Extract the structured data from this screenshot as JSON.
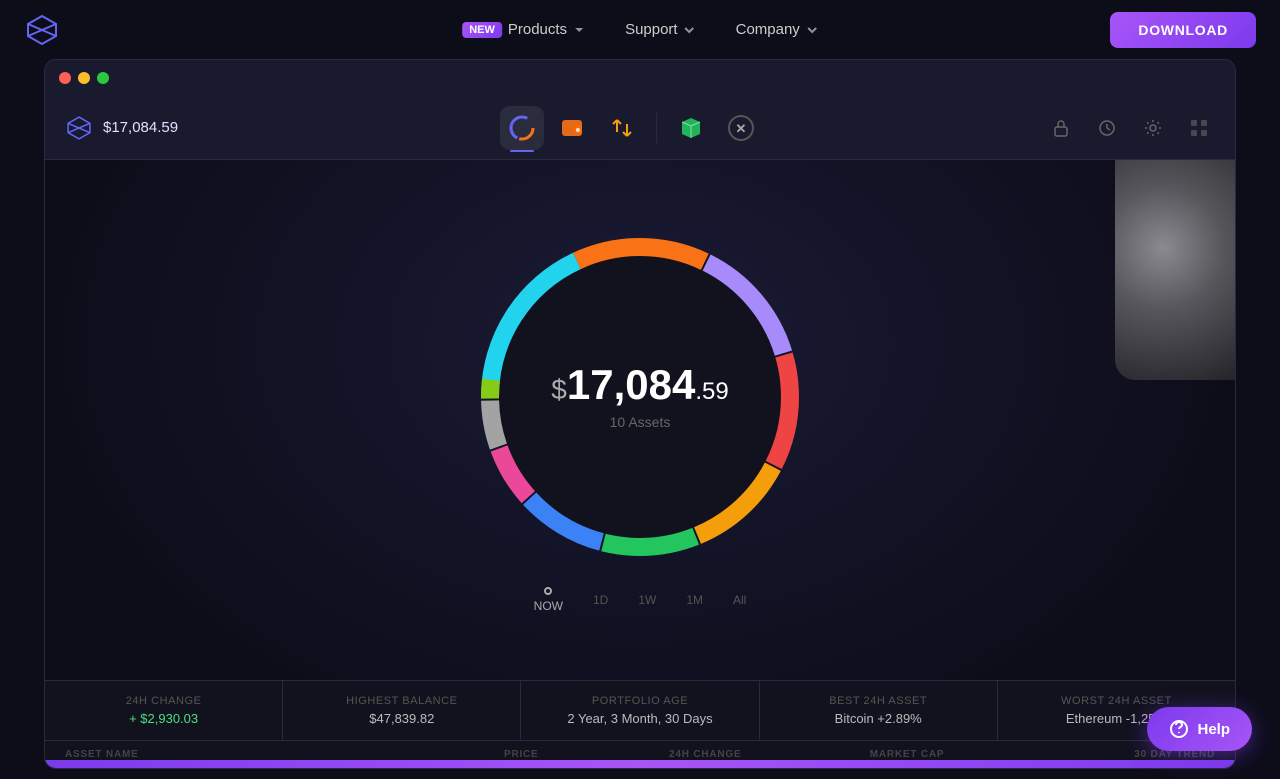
{
  "nav": {
    "products_badge": "NEW",
    "products_label": "Products",
    "support_label": "Support",
    "company_label": "Company",
    "download_label": "DOWNLOAD"
  },
  "window": {
    "titlebar_dots": [
      "red",
      "yellow",
      "green"
    ]
  },
  "toolbar": {
    "balance": "$17,084.59",
    "tabs": [
      {
        "id": "portfolio",
        "label": "Portfolio",
        "active": true
      },
      {
        "id": "wallet",
        "label": "Wallet",
        "active": false
      },
      {
        "id": "swap",
        "label": "Swap",
        "active": false
      },
      {
        "id": "staking",
        "label": "Staking",
        "active": false
      },
      {
        "id": "x",
        "label": "X",
        "active": false
      }
    ]
  },
  "chart": {
    "amount_dollar": "$",
    "amount_main": "17,084",
    "amount_cents": ".59",
    "assets_label": "10 Assets",
    "segments": [
      {
        "color": "#22d3ee",
        "pct": 18
      },
      {
        "color": "#f97316",
        "pct": 14
      },
      {
        "color": "#a78bfa",
        "pct": 13
      },
      {
        "color": "#ef4444",
        "pct": 12
      },
      {
        "color": "#f59e0b",
        "pct": 11
      },
      {
        "color": "#22c55e",
        "pct": 10
      },
      {
        "color": "#3b82f6",
        "pct": 9
      },
      {
        "color": "#ec4899",
        "pct": 6
      },
      {
        "color": "#a3a3a3",
        "pct": 5
      },
      {
        "color": "#84cc16",
        "pct": 2
      }
    ]
  },
  "timeSelector": {
    "items": [
      {
        "label": "NOW",
        "active": true
      },
      {
        "label": "1D",
        "active": false
      },
      {
        "label": "1W",
        "active": false
      },
      {
        "label": "1M",
        "active": false
      },
      {
        "label": "All",
        "active": false
      }
    ]
  },
  "stats": [
    {
      "label": "24h Change",
      "value": "+ $2,930.03",
      "positive": true
    },
    {
      "label": "Highest Balance",
      "value": "$47,839.82",
      "positive": false
    },
    {
      "label": "Portfolio Age",
      "value": "2 Year, 3 Month, 30 Days",
      "positive": false
    },
    {
      "label": "Best 24H Asset",
      "value": "Bitcoin +2.89%",
      "positive": false
    },
    {
      "label": "Worst 24H Asset",
      "value": "Ethereum -1,25%",
      "positive": false
    }
  ],
  "tableHeader": {
    "asset_name": "ASSET NAME",
    "price": "PRICE",
    "change_24h": "24H CHANGE",
    "market_cap": "MARKET CAP",
    "trend_30d": "30 DAY TREND"
  },
  "help": {
    "label": "Help"
  }
}
